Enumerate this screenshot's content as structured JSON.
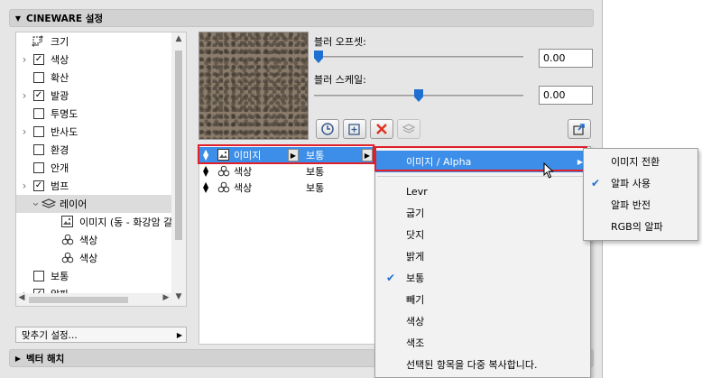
{
  "panel": {
    "title": "CINEWARE 설정",
    "bottom_section": "벡터 해치"
  },
  "tree": {
    "items": [
      {
        "label": "크기",
        "indent": 0,
        "checkbox": null,
        "expander": false,
        "icon": "size-icon"
      },
      {
        "label": "색상",
        "indent": 0,
        "checkbox": true,
        "expander": true
      },
      {
        "label": "확산",
        "indent": 0,
        "checkbox": false,
        "expander": false
      },
      {
        "label": "발광",
        "indent": 0,
        "checkbox": true,
        "expander": true
      },
      {
        "label": "투명도",
        "indent": 0,
        "checkbox": false,
        "expander": false
      },
      {
        "label": "반사도",
        "indent": 0,
        "checkbox": false,
        "expander": true
      },
      {
        "label": "환경",
        "indent": 0,
        "checkbox": false,
        "expander": false
      },
      {
        "label": "안개",
        "indent": 0,
        "checkbox": false,
        "expander": false
      },
      {
        "label": "범프",
        "indent": 0,
        "checkbox": true,
        "expander": true
      },
      {
        "label": "레이어",
        "indent": 1,
        "checkbox": null,
        "expander": true,
        "icon": "layers-icon",
        "selected": true
      },
      {
        "label": "이미지 (동 - 화강암 갈색",
        "indent": 2,
        "checkbox": null,
        "expander": false,
        "icon": "image-icon"
      },
      {
        "label": "색상",
        "indent": 2,
        "checkbox": null,
        "expander": false,
        "icon": "color-circles-icon"
      },
      {
        "label": "색상",
        "indent": 2,
        "checkbox": null,
        "expander": false,
        "icon": "color-circles-icon"
      },
      {
        "label": "보통",
        "indent": 0,
        "checkbox": false,
        "expander": false
      },
      {
        "label": "알파",
        "indent": 0,
        "checkbox": true,
        "expander": true
      }
    ]
  },
  "fit_settings": {
    "label": "맞추기 설정..."
  },
  "params": {
    "blur_offset_label": "블러 오프셋:",
    "blur_offset_value": "0.00",
    "blur_offset_level": 0.0,
    "blur_scale_label": "블러 스케일:",
    "blur_scale_value": "0.00",
    "blur_scale_level": 0.5
  },
  "layers": [
    {
      "name": "이미지",
      "mode": "보통",
      "icon": "image-icon",
      "selected": true
    },
    {
      "name": "색상",
      "mode": "보통",
      "icon": "color-circles-icon"
    },
    {
      "name": "색상",
      "mode": "보통",
      "icon": "color-circles-icon"
    }
  ],
  "context_menu": {
    "items": [
      {
        "label": "이미지 / Alpha",
        "highlighted": true,
        "submenu": true
      },
      {
        "label": "Levr"
      },
      {
        "label": "굽기"
      },
      {
        "label": "닷지"
      },
      {
        "label": "밝게"
      },
      {
        "label": "보통",
        "checked": true
      },
      {
        "label": "빼기"
      },
      {
        "label": "색상"
      },
      {
        "label": "색조"
      },
      {
        "label": "선택된 항목을 다중 복사합니다."
      }
    ],
    "check_glyph": "✔"
  },
  "submenu": {
    "items": [
      {
        "label": "이미지 전환"
      },
      {
        "label": "알파 사용",
        "checked": true
      },
      {
        "label": "알파 반전"
      },
      {
        "label": "RGB의 알파"
      }
    ]
  },
  "colors": {
    "highlight": "#3d8ee8",
    "red_frame": "#e01f2b",
    "delete_x": "#e03020"
  }
}
